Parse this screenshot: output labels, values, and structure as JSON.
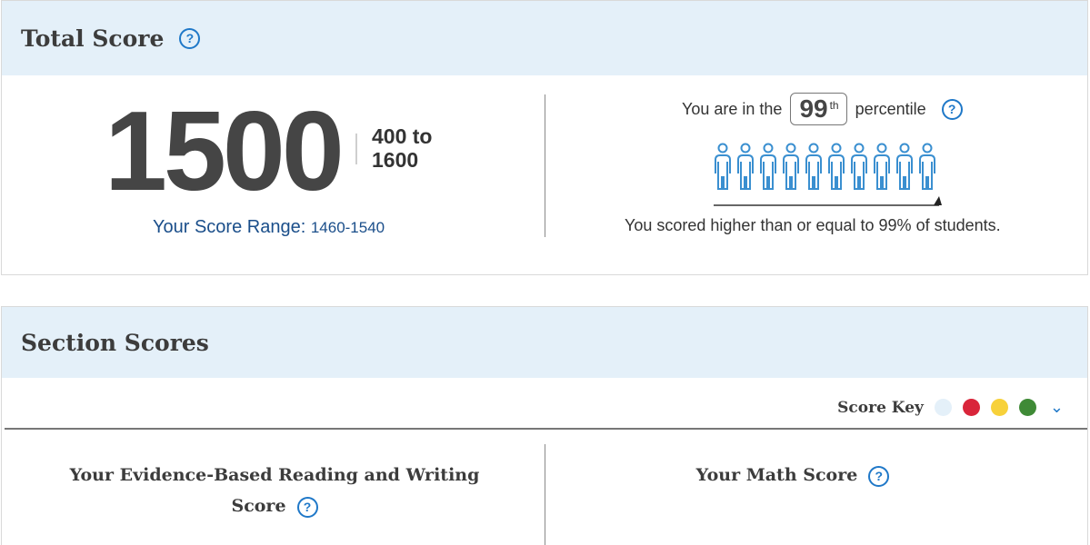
{
  "total": {
    "title": "Total Score",
    "score": "1500",
    "range_low_line": "400 to",
    "range_high_line": "1600",
    "score_range_label": "Your Score Range:",
    "score_range_value": "1460-1540",
    "percentile_prefix": "You are in the",
    "percentile_value": "99",
    "percentile_suffix_sup": "th",
    "percentile_word": "percentile",
    "percentile_caption": "You scored higher than or equal to 99% of students.",
    "help_glyph": "?"
  },
  "section": {
    "title": "Section Scores",
    "score_key_label": "Score Key",
    "score_key_colors": [
      "#e4f0f9",
      "#d9253a",
      "#f7d13a",
      "#3f8a36"
    ],
    "reading_title_line1": "Your Evidence-Based Reading and Writing",
    "reading_title_line2": "Score",
    "math_title": "Your Math Score",
    "chevron": "⌄"
  },
  "colors": {
    "header_bg": "#e4f0f9",
    "accent": "#1f78c8",
    "range_text": "#1a4e8a"
  }
}
